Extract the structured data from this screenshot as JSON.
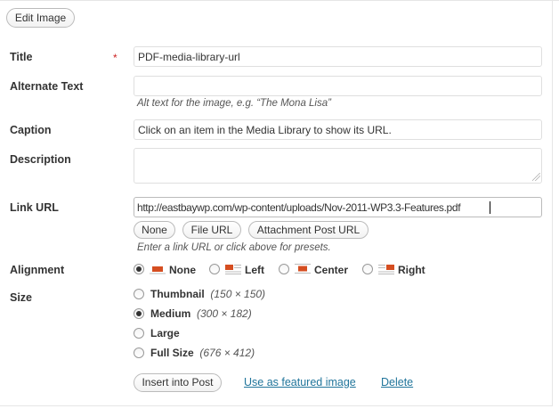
{
  "toolbar": {
    "edit_image_label": "Edit Image"
  },
  "form": {
    "title": {
      "label": "Title",
      "required_mark": "*",
      "value": "PDF-media-library-url"
    },
    "alt_text": {
      "label": "Alternate Text",
      "value": "",
      "help": "Alt text for the image, e.g. “The Mona Lisa”"
    },
    "caption": {
      "label": "Caption",
      "value": "Click on an item in the Media Library to show its URL."
    },
    "description": {
      "label": "Description",
      "value": ""
    },
    "link_url": {
      "label": "Link URL",
      "value": "http://eastbaywp.com/wp-content/uploads/Nov-2011-WP3.3-Features.pdf",
      "preset_none": "None",
      "preset_file": "File URL",
      "preset_post": "Attachment Post URL",
      "help": "Enter a link URL or click above for presets."
    },
    "alignment": {
      "label": "Alignment",
      "selected": "None",
      "options": [
        "None",
        "Left",
        "Center",
        "Right"
      ]
    },
    "size": {
      "label": "Size",
      "selected": "Medium",
      "options": [
        {
          "label": "Thumbnail",
          "dims": "(150 × 150)"
        },
        {
          "label": "Medium",
          "dims": "(300 × 182)"
        },
        {
          "label": "Large",
          "dims": ""
        },
        {
          "label": "Full Size",
          "dims": "(676 × 412)"
        }
      ]
    }
  },
  "actions": {
    "insert_label": "Insert into Post",
    "featured_label": "Use as featured image",
    "delete_label": "Delete"
  },
  "colors": {
    "link": "#21759b",
    "required": "#cc2222",
    "icon_red": "#d54e21"
  },
  "icons": {
    "align_none": "align-none-icon",
    "align_left": "align-left-icon",
    "align_center": "align-center-icon",
    "align_right": "align-right-icon"
  }
}
